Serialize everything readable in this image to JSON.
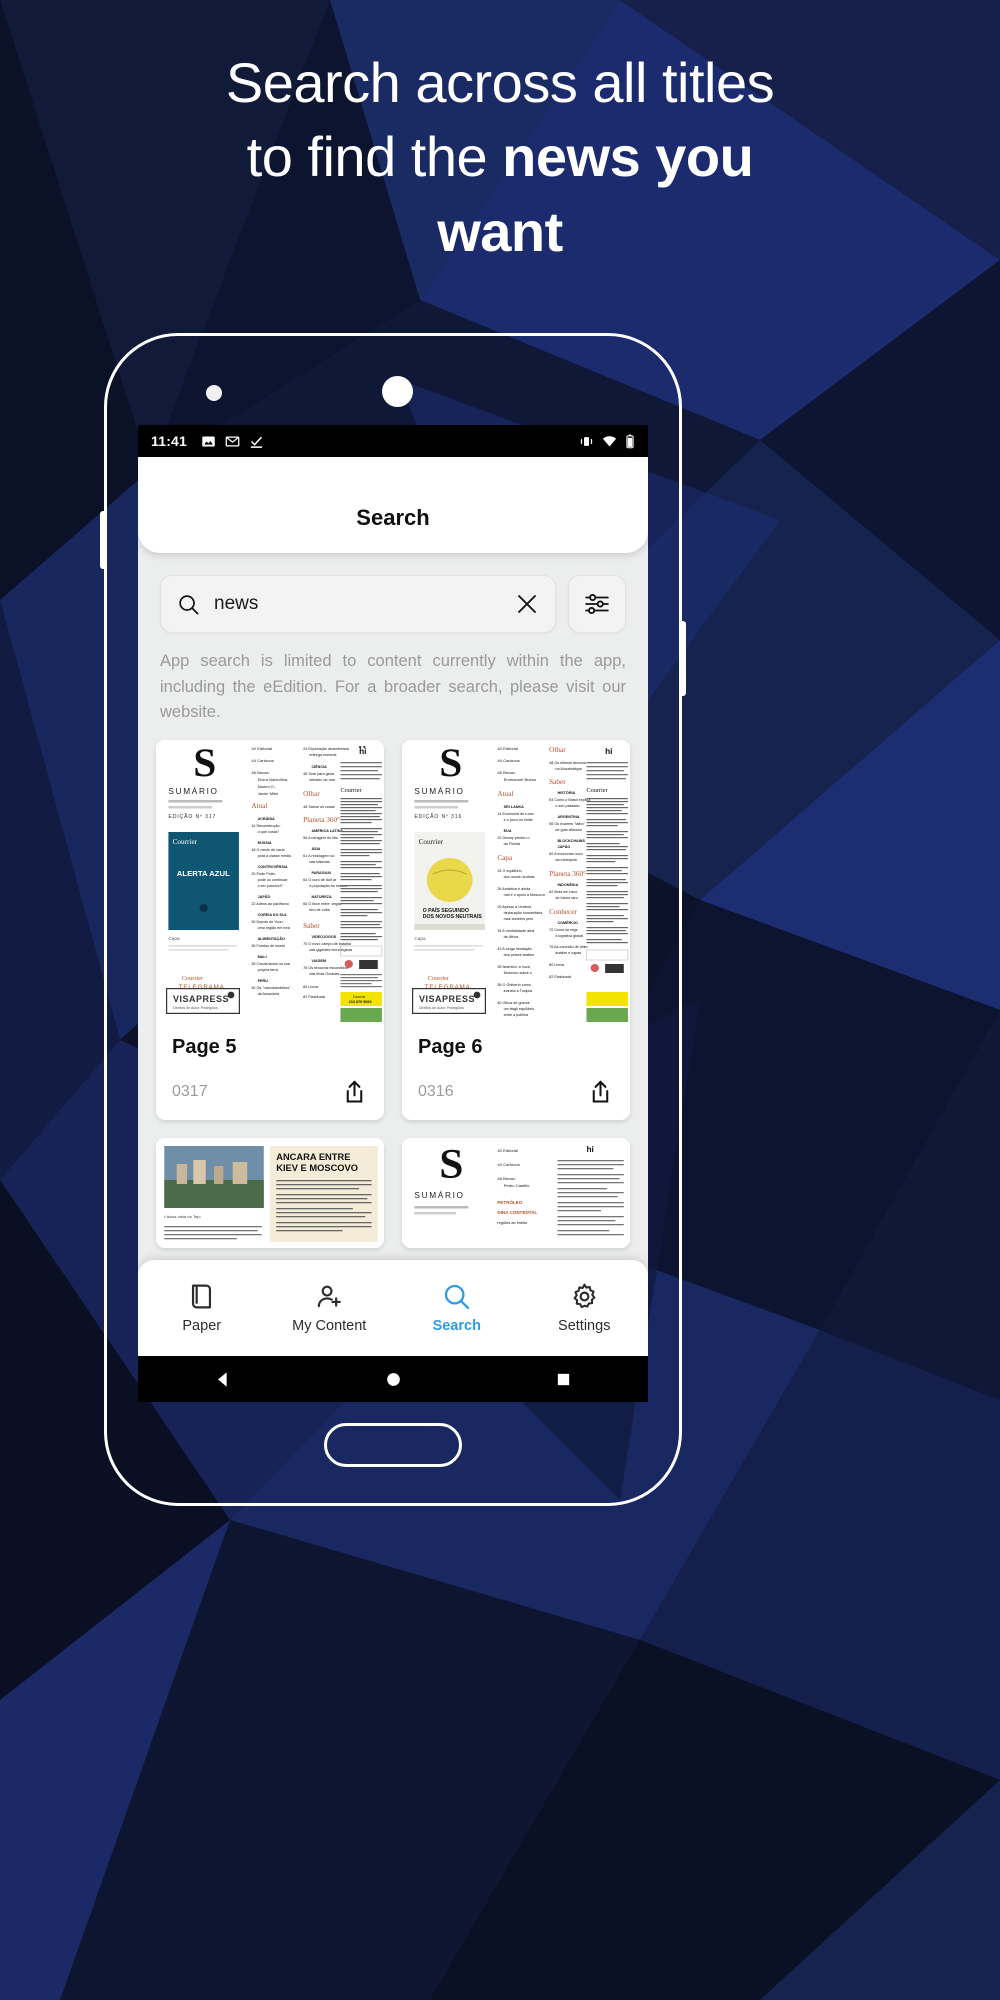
{
  "headline": {
    "line1": "Search across all titles",
    "line2_pre": "to find the ",
    "line2_bold": "news you",
    "line3_bold": "want"
  },
  "statusbar": {
    "time": "11:41",
    "left_icons": [
      "image-icon",
      "gmail-icon",
      "task-check-icon"
    ],
    "right_icons": [
      "vibrate-icon",
      "wifi-icon",
      "battery-icon"
    ]
  },
  "header": {
    "title": "Search"
  },
  "search": {
    "value": "news",
    "placeholder": "Search",
    "search_icon": "search-icon",
    "clear_icon": "close-icon",
    "filter_icon": "filter-sliders-icon"
  },
  "disclaimer": "App search is limited to content currently within the app, including the eEdition. For a broader search, please visit our website.",
  "results": [
    {
      "title": "Page 5",
      "number": "0317",
      "share_icon": "share-icon",
      "thumb": "magazine-contents-a"
    },
    {
      "title": "Page 6",
      "number": "0316",
      "share_icon": "share-icon",
      "thumb": "magazine-contents-b"
    },
    {
      "title": "",
      "number": "",
      "share_icon": "share-icon",
      "thumb": "magazine-article-c"
    },
    {
      "title": "",
      "number": "",
      "share_icon": "share-icon",
      "thumb": "magazine-contents-d"
    }
  ],
  "bottomnav": {
    "items": [
      {
        "label": "Paper",
        "icon": "paper-book-icon",
        "active": false
      },
      {
        "label": "My Content",
        "icon": "person-add-icon",
        "active": false
      },
      {
        "label": "Search",
        "icon": "search-icon",
        "active": true
      },
      {
        "label": "Settings",
        "icon": "gear-icon",
        "active": false
      }
    ],
    "active_color": "#2f9be8"
  },
  "androidnav": {
    "back": "back-triangle-icon",
    "home": "home-circle-icon",
    "recents": "recents-square-icon"
  },
  "colors": {
    "bg_dark": "#0a0f1f",
    "bg_blue": "#1d2d6b",
    "accent": "#2f9be8",
    "screen_bg": "#eceded"
  },
  "thumb_content": {
    "magazine_masthead": "SUMÁRIO",
    "publisher_mark": "VISAPRESS",
    "publisher_sub": "Direitos de Autor Protegidos",
    "cover_label": "Capa",
    "sections": [
      "Atual",
      "Capa",
      "Olhar",
      "Planeta 360°",
      "Saber",
      "Conhecer"
    ],
    "cover_title": "ALERTA AZUL",
    "newsletter": "TELEGRAMA",
    "headline_c": "ANCARA ENTRE KIEV E MOSCOVO"
  }
}
